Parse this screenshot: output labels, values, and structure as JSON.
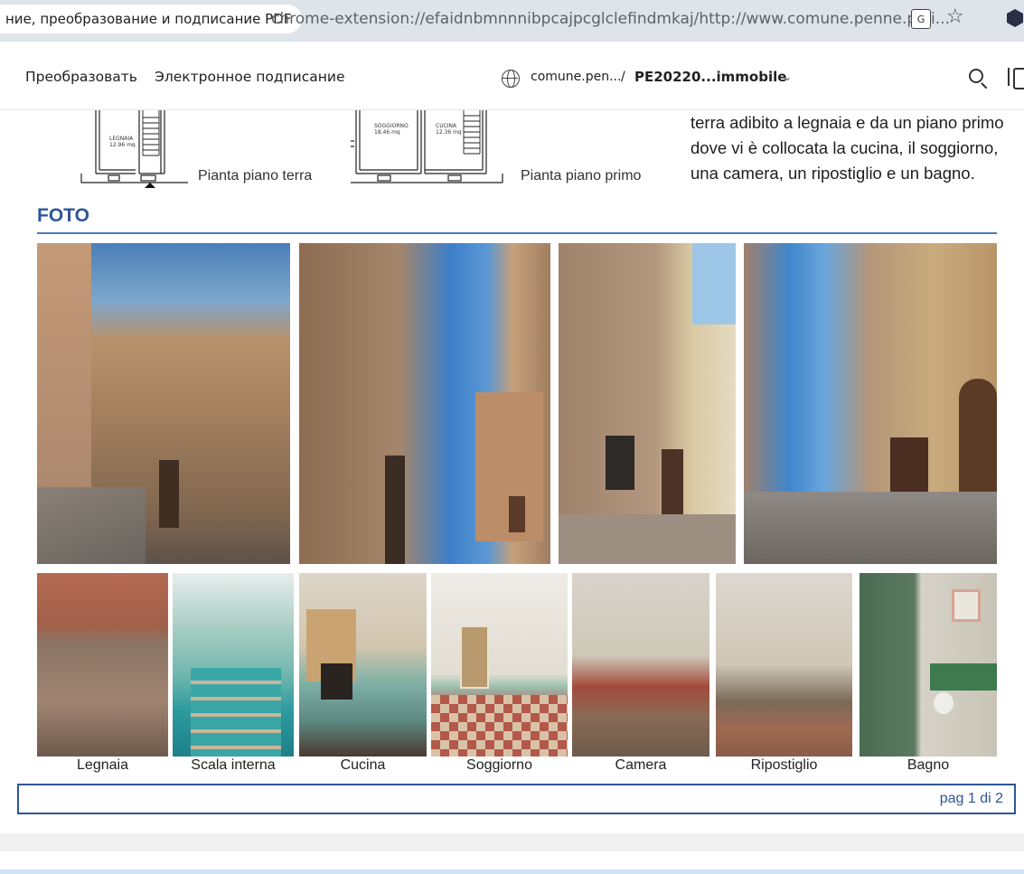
{
  "browser": {
    "tab_title": "ние, преобразование и подписание PDF",
    "url": "chrome-extension://efaidnbmnnnibpcajpcglclefindmkaj/http://www.comune.penne.pe.i..."
  },
  "pdf_toolbar": {
    "convert_label": "Преобразовать",
    "sign_label": "Электронное подписание",
    "domain": "comune.pen...",
    "separator": "/",
    "file_name": "PE20220...immobile"
  },
  "floorplans": {
    "ground": {
      "room_name": "LEGNAIA",
      "room_area": "12.96 mq",
      "caption": "Pianta piano terra"
    },
    "first": {
      "room1_name": "SOGGIORNO",
      "room1_area": "18.46 mq",
      "room2_name": "CUCINA",
      "room2_area": "12.36 mq",
      "caption": "Pianta piano primo"
    }
  },
  "description": {
    "line1": "terra adibito a legnaia e da un piano primo",
    "line2": "dove vi è collocata la cucina, il soggiorno,",
    "line3": "una camera, un ripostiglio e un bagno."
  },
  "section": {
    "title": "FOTO"
  },
  "exterior_photos": [
    {
      "name": "exterior-photo-1"
    },
    {
      "name": "exterior-photo-2"
    },
    {
      "name": "exterior-photo-3"
    },
    {
      "name": "exterior-photo-4"
    }
  ],
  "interior_photos": [
    {
      "caption": "Legnaia"
    },
    {
      "caption": "Scala interna"
    },
    {
      "caption": "Cucina"
    },
    {
      "caption": "Soggiorno"
    },
    {
      "caption": "Camera"
    },
    {
      "caption": "Ripostiglio"
    },
    {
      "caption": "Bagno"
    }
  ],
  "pager": {
    "text": "pag 1 di 2"
  },
  "colors": {
    "accent": "#2f5597",
    "rule": "#4f79b8",
    "chrome": "#dfe3ea"
  }
}
